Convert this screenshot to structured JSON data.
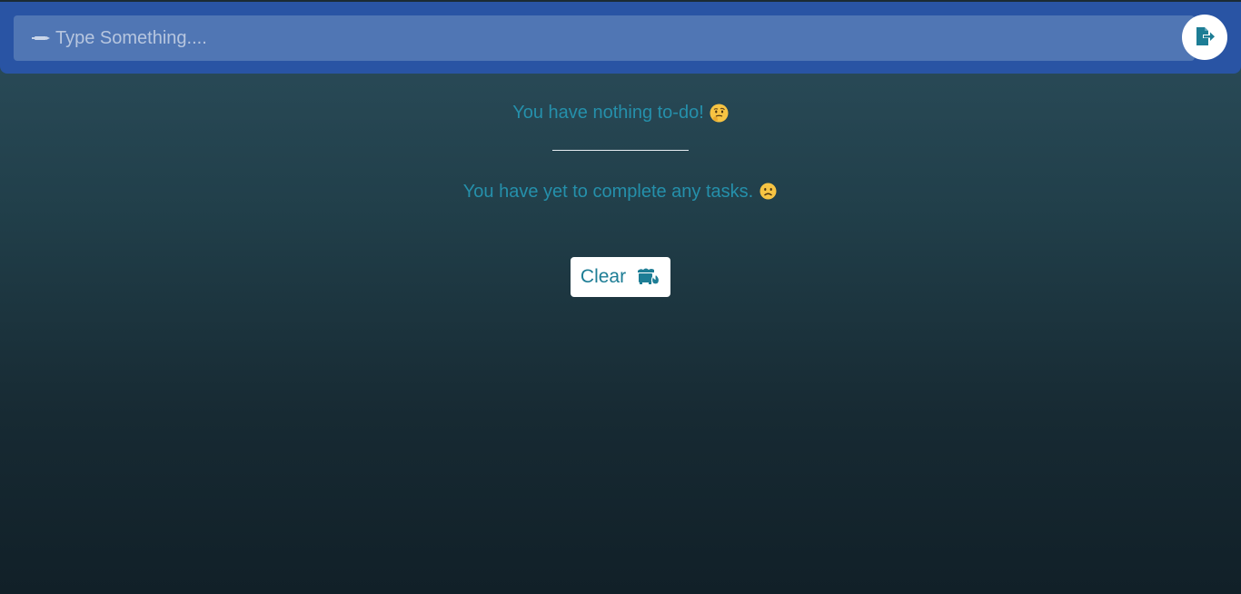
{
  "input": {
    "value": "",
    "placeholder": "Type Something...."
  },
  "icons": {
    "input_leading": "pen-icon",
    "submit": "file-export-icon",
    "todo_emoji": "thinking-face-icon",
    "done_emoji": "frowning-face-icon",
    "clear": "dumpster-fire-icon"
  },
  "messages": {
    "todo_empty": "You have nothing to-do!",
    "done_empty": "You have yet to complete any tasks."
  },
  "clear_button": {
    "label": "Clear"
  },
  "colors": {
    "header": "#2954a4",
    "input_bg": "#5076b4",
    "message_text": "#2590ab",
    "button_text": "#1d7d95"
  }
}
